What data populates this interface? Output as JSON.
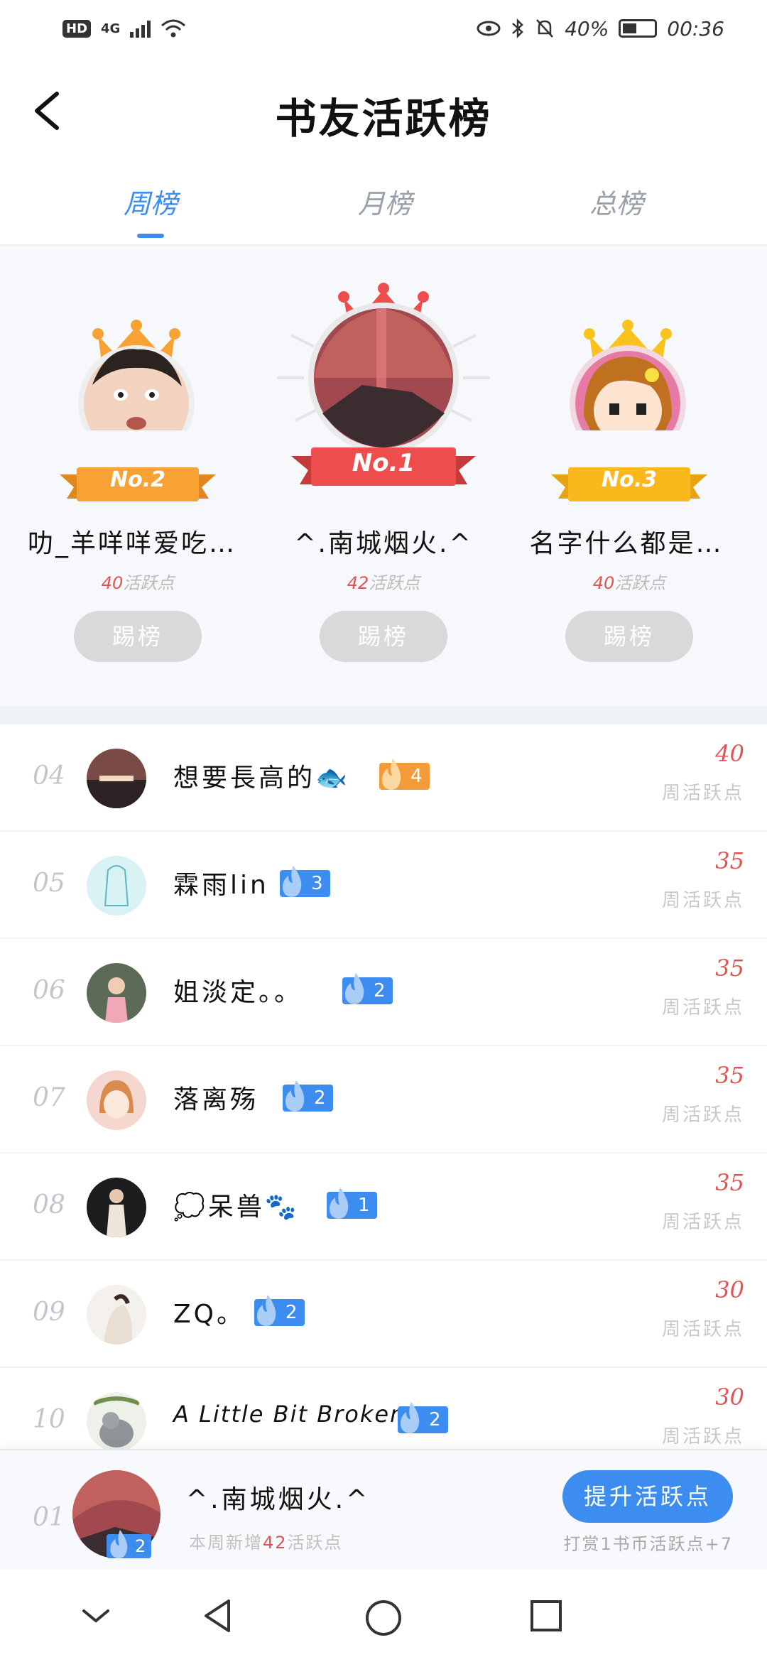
{
  "status": {
    "battery": "40%",
    "time": "00:36",
    "net": "4G",
    "hd": "HD"
  },
  "header": {
    "title": "书友活跃榜"
  },
  "tabs": [
    {
      "label": "周榜",
      "active": true
    },
    {
      "label": "月榜",
      "active": false
    },
    {
      "label": "总榜",
      "active": false
    }
  ],
  "podium": [
    {
      "badge": "No.2",
      "name": "叻_羊咩咩爱吃…",
      "points": "40",
      "points_suffix": "活跃点",
      "button": "踢榜"
    },
    {
      "badge": "No.1",
      "name": "^.南城烟火.^",
      "points": "42",
      "points_suffix": "活跃点",
      "button": "踢榜"
    },
    {
      "badge": "No.3",
      "name": "名字什么都是…",
      "points": "40",
      "points_suffix": "活跃点",
      "button": "踢榜"
    }
  ],
  "rows": [
    {
      "rank": "04",
      "name": "想要長高的🐟",
      "level": "4",
      "score": "40",
      "label": "周活跃点",
      "color": "#f29b38"
    },
    {
      "rank": "05",
      "name": "霖雨lin",
      "level": "3",
      "score": "35",
      "label": "周活跃点",
      "color": "#3d8cf0"
    },
    {
      "rank": "06",
      "name": "姐淡定。。",
      "level": "2",
      "score": "35",
      "label": "周活跃点",
      "color": "#3d8cf0"
    },
    {
      "rank": "07",
      "name": "落离殇",
      "level": "2",
      "score": "35",
      "label": "周活跃点",
      "color": "#3d8cf0"
    },
    {
      "rank": "08",
      "name": "💭呆兽🐾",
      "level": "1",
      "score": "35",
      "label": "周活跃点",
      "color": "#3d8cf0"
    },
    {
      "rank": "09",
      "name": "ZQ。",
      "level": "2",
      "score": "30",
      "label": "周活跃点",
      "color": "#3d8cf0"
    },
    {
      "rank": "10",
      "name": "A Little Bit Broken",
      "level": "2",
      "score": "30",
      "label": "周活跃点",
      "color": "#3d8cf0"
    }
  ],
  "me": {
    "rank": "01",
    "name": "^.南城烟火.^",
    "level": "2",
    "sub_prefix": "本周新增",
    "sub_points": "42",
    "sub_suffix": "活跃点",
    "button": "提升活跃点",
    "tip": "打赏1书币活跃点+7"
  }
}
